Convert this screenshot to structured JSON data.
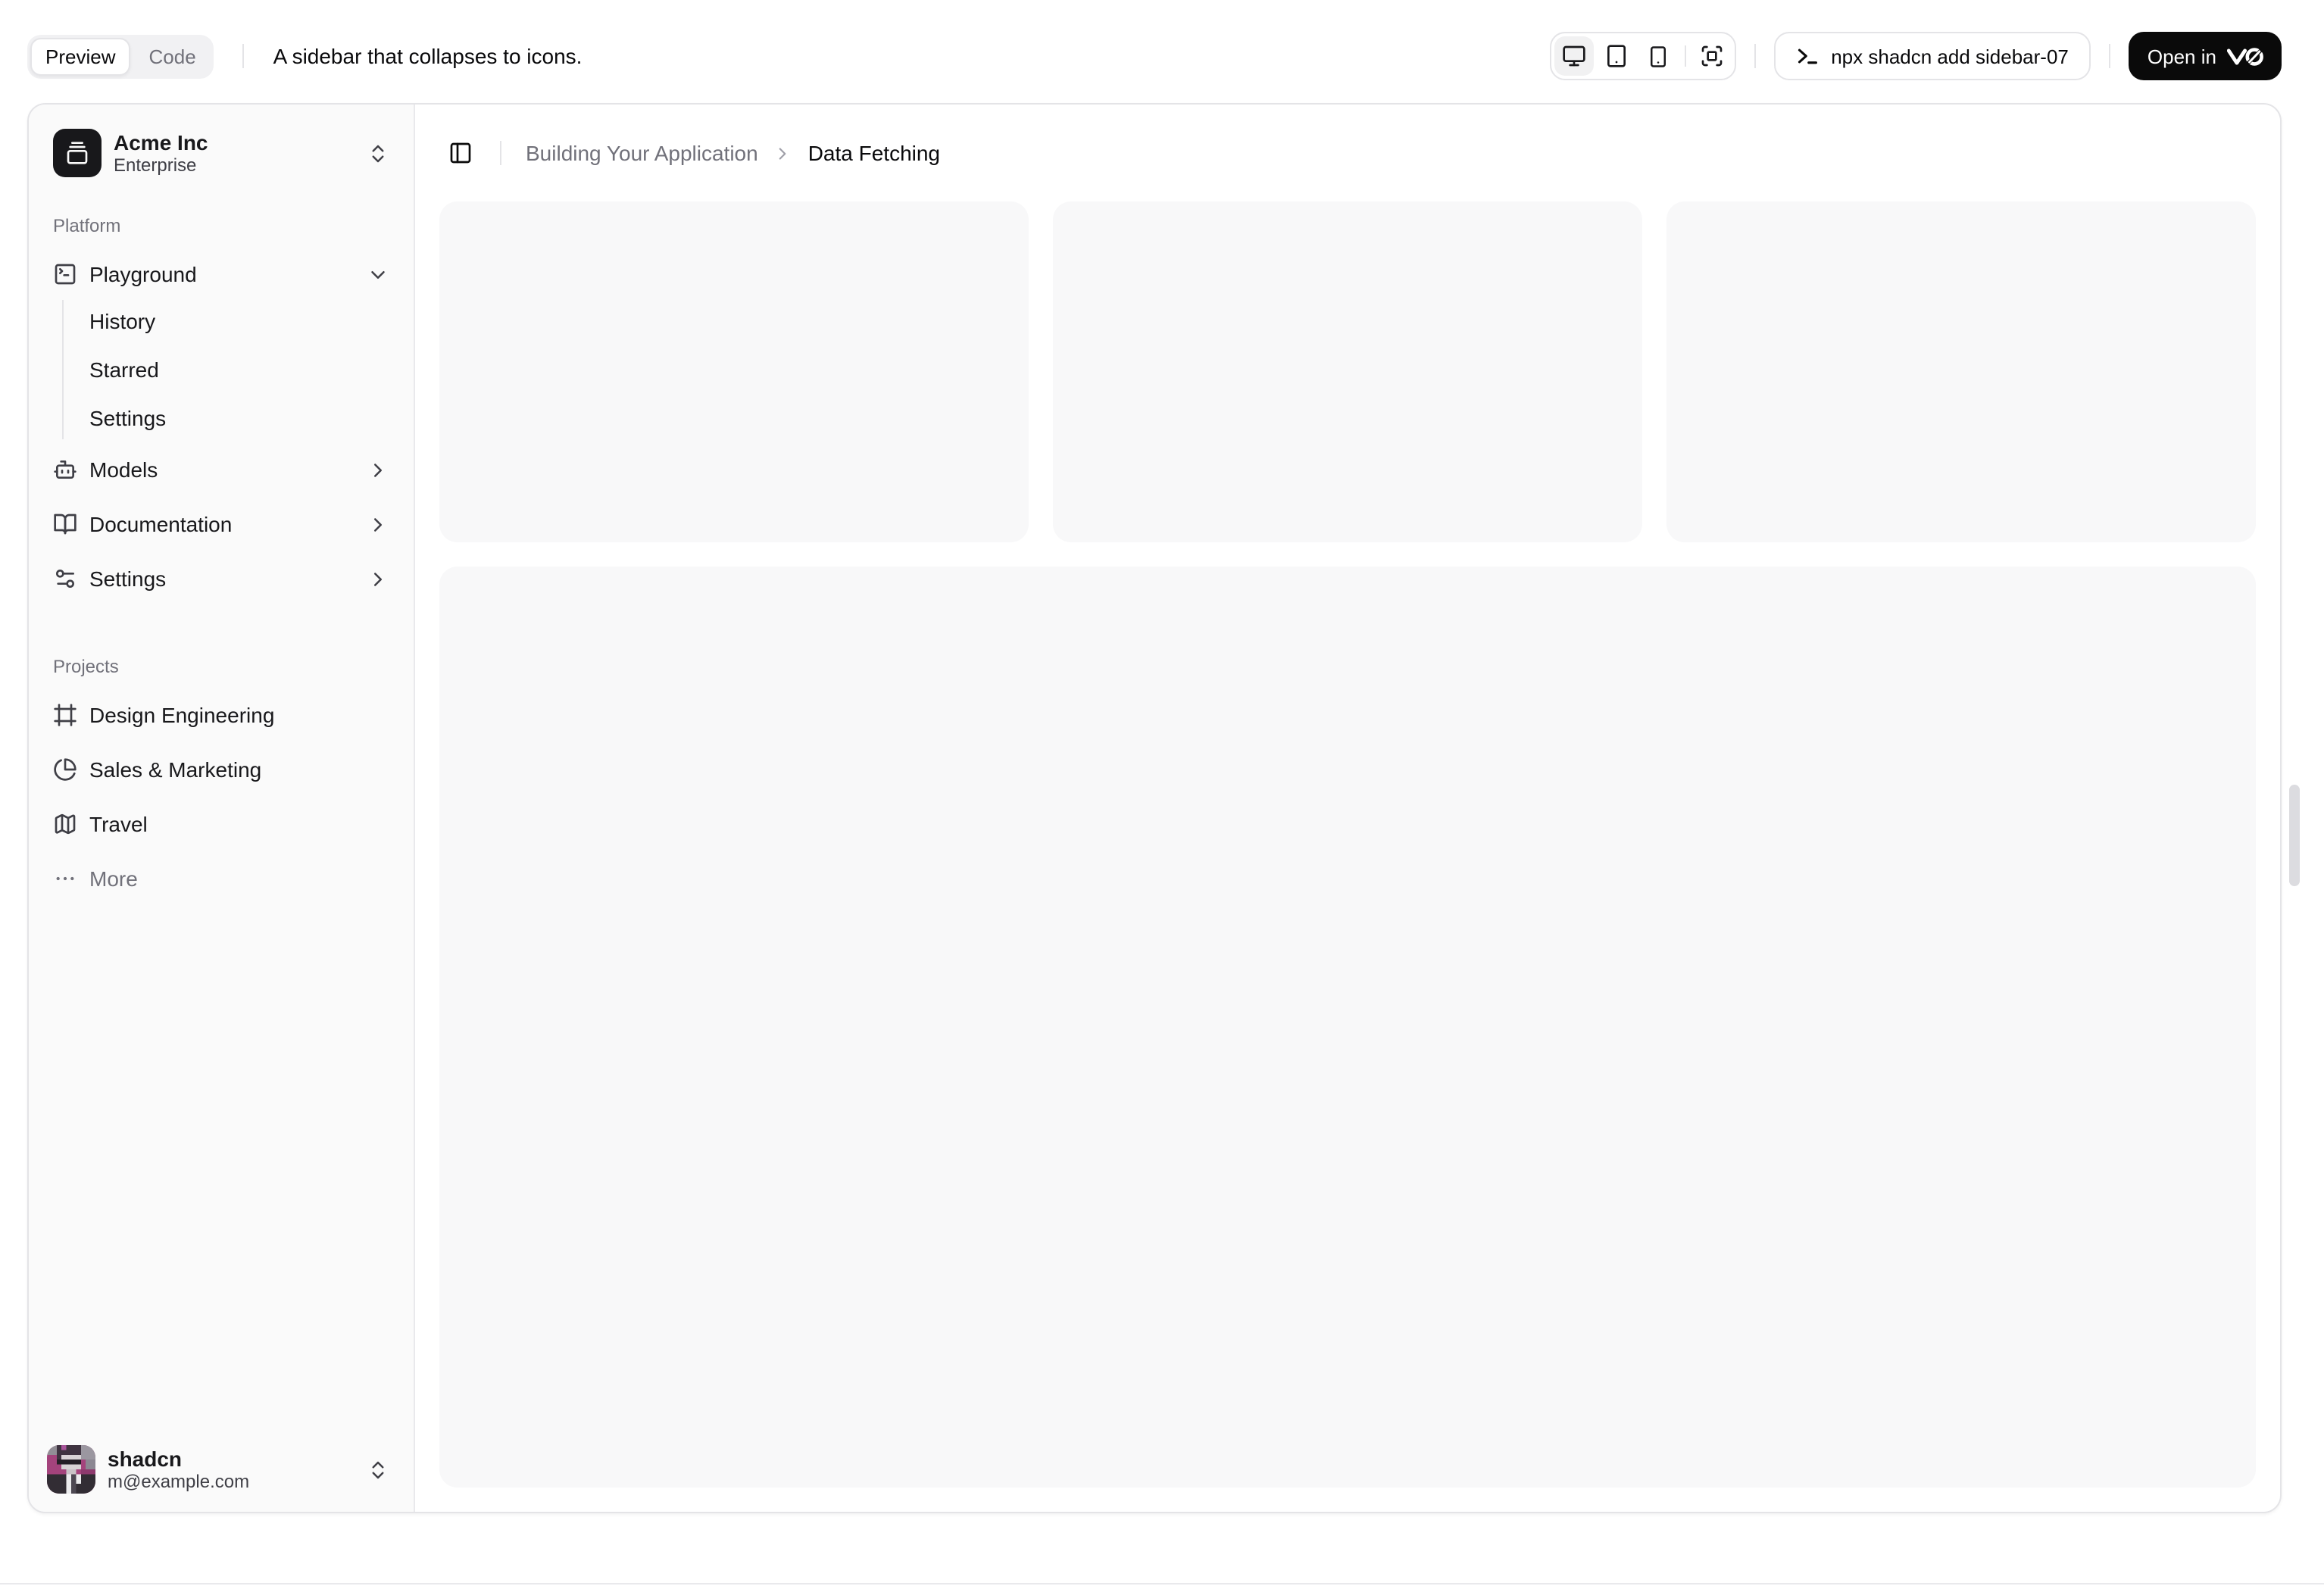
{
  "colors": {
    "accent": "#0a0a0a",
    "border": "#e4e4e7",
    "sidebar_bg": "#fafafa",
    "placeholder_bg": "#f8f8f9",
    "muted_text": "#71717a",
    "text": "#18181b"
  },
  "toolbar": {
    "tabs": [
      {
        "label": "Preview",
        "active": true
      },
      {
        "label": "Code",
        "active": false
      }
    ],
    "description": "A sidebar that collapses to icons.",
    "devices": [
      {
        "name": "desktop",
        "active": true
      },
      {
        "name": "tablet",
        "active": false
      },
      {
        "name": "mobile",
        "active": false
      },
      {
        "name": "fullscreen",
        "active": false
      }
    ],
    "command": "npx shadcn add sidebar-07",
    "open_button": {
      "label": "Open in",
      "logo": "v0"
    }
  },
  "sidebar": {
    "team": {
      "name": "Acme Inc",
      "plan": "Enterprise"
    },
    "groups": [
      {
        "label": "Platform",
        "items": [
          {
            "label": "Playground",
            "icon": "square-terminal-icon",
            "state": "expanded",
            "children": [
              {
                "label": "History"
              },
              {
                "label": "Starred"
              },
              {
                "label": "Settings"
              }
            ]
          },
          {
            "label": "Models",
            "icon": "bot-icon"
          },
          {
            "label": "Documentation",
            "icon": "book-open-icon"
          },
          {
            "label": "Settings",
            "icon": "settings-icon"
          }
        ]
      },
      {
        "label": "Projects",
        "items": [
          {
            "label": "Design Engineering",
            "icon": "frame-icon"
          },
          {
            "label": "Sales & Marketing",
            "icon": "pie-chart-icon"
          },
          {
            "label": "Travel",
            "icon": "map-icon"
          },
          {
            "label": "More",
            "icon": "ellipsis-icon"
          }
        ]
      }
    ],
    "user": {
      "name": "shadcn",
      "email": "m@example.com"
    }
  },
  "main": {
    "breadcrumb": {
      "section": "Building Your Application",
      "page": "Data Fetching"
    }
  }
}
